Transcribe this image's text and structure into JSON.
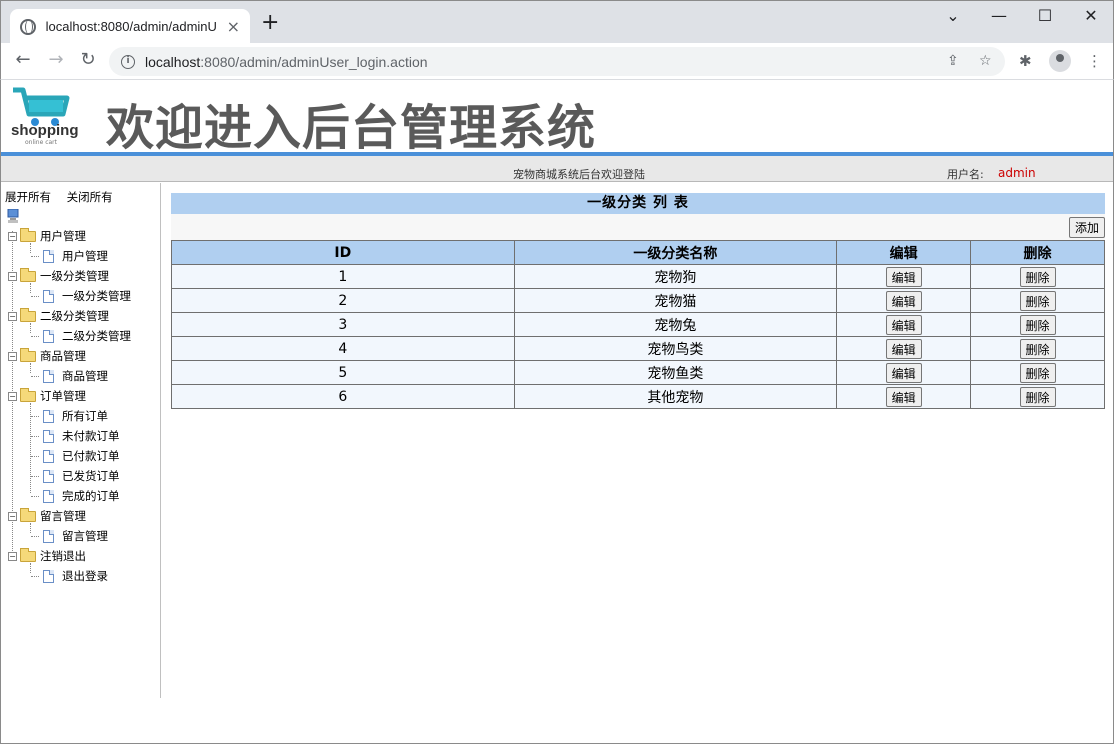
{
  "browser": {
    "tab_title": "localhost:8080/admin/adminU",
    "tab_close": "×",
    "new_tab": "+",
    "url_host": "localhost",
    "url_rest": ":8080/admin/adminUser_login.action",
    "back": "←",
    "forward": "→",
    "reload": "↻",
    "minimize": "—",
    "maximize": "☐",
    "close": "✕",
    "chevron": "⌄",
    "share": "⇪",
    "star": "☆",
    "extensions": "✱",
    "menu": "⋮"
  },
  "header": {
    "logo_text": "shopping",
    "logo_sub": "online cart",
    "title": "欢迎进入后台管理系统"
  },
  "status": {
    "welcome": "宠物商城系统后台欢迎登陆",
    "username_label": "用户名:",
    "username": "admin"
  },
  "sidebar": {
    "expand_all": "展开所有",
    "collapse_all": "关闭所有",
    "groups": [
      {
        "label": "用户管理",
        "items": [
          "用户管理"
        ]
      },
      {
        "label": "一级分类管理",
        "items": [
          "一级分类管理"
        ]
      },
      {
        "label": "二级分类管理",
        "items": [
          "二级分类管理"
        ]
      },
      {
        "label": "商品管理",
        "items": [
          "商品管理"
        ]
      },
      {
        "label": "订单管理",
        "items": [
          "所有订单",
          "未付款订单",
          "已付款订单",
          "已发货订单",
          "完成的订单"
        ]
      },
      {
        "label": "留言管理",
        "items": [
          "留言管理"
        ]
      },
      {
        "label": "注销退出",
        "items": [
          "退出登录"
        ]
      }
    ]
  },
  "main": {
    "title": "一级分类 列 表",
    "add_label": "添加",
    "columns": [
      "ID",
      "一级分类名称",
      "编辑",
      "删除"
    ],
    "edit_label": "编辑",
    "delete_label": "删除",
    "rows": [
      {
        "id": "1",
        "name": "宠物狗"
      },
      {
        "id": "2",
        "name": "宠物猫"
      },
      {
        "id": "3",
        "name": "宠物兔"
      },
      {
        "id": "4",
        "name": "宠物鸟类"
      },
      {
        "id": "5",
        "name": "宠物鱼类"
      },
      {
        "id": "6",
        "name": "其他宠物"
      }
    ]
  },
  "colors": {
    "accent_blue": "#4a90d9",
    "table_header": "#b0cff0",
    "username": "#cc0000"
  }
}
